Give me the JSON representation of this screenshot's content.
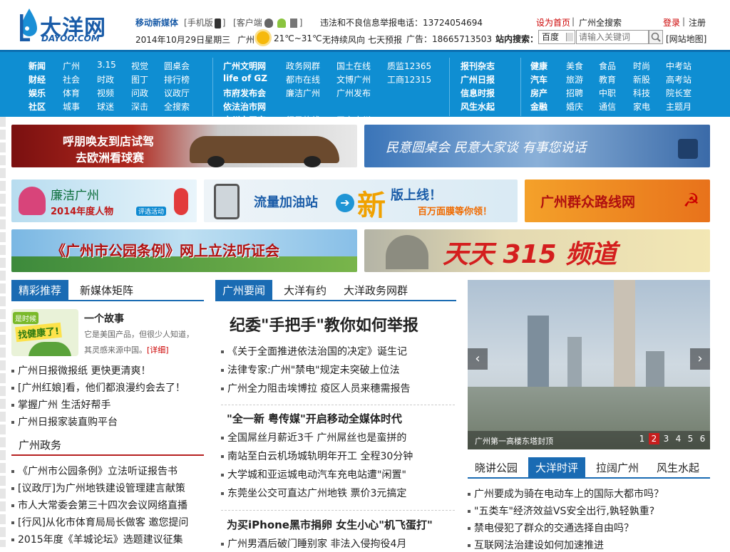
{
  "header": {
    "logo_cn": "大洋网",
    "logo_en": "DAYOO.COM",
    "new_media_label": "移动新媒体",
    "phone_version": "手机版",
    "client": "客户端",
    "report_phone": "违法和不良信息举报电话：13724054694",
    "set_home": "设为首页",
    "gz_search": "广州全搜索",
    "login": "登录",
    "register": "注册",
    "date": "2014年10月29日星期三",
    "city": "广州",
    "temp": "21℃~31℃",
    "wind": "无持续风向",
    "forecast": "七天预报",
    "ad_phone": "广告：18665713503",
    "site_search_label": "站内搜索：",
    "search_select": "百度",
    "search_placeholder": "请输入关键词",
    "sitemap": "[网站地图]"
  },
  "nav": {
    "group1": [
      [
        "新闻",
        "广州",
        "3.15",
        "视觉",
        "圆桌会"
      ],
      [
        "财经",
        "社会",
        "时政",
        "图丁",
        "排行榜"
      ],
      [
        "娱乐",
        "体育",
        "视频",
        "问政",
        "议政厅"
      ],
      [
        "社区",
        "城事",
        "球迷",
        "深击",
        "全搜索"
      ]
    ],
    "group2": [
      [
        "广州文明网",
        "政务网群",
        "国土在线",
        "质监12365"
      ],
      [
        "life of GZ",
        "都市在线",
        "文博广州",
        "工商12315"
      ],
      [
        "市府发布会",
        "廉洁广州",
        "广州发布",
        ""
      ],
      [
        "依法治市网",
        "",
        "",
        ""
      ],
      [
        "广州市平安",
        "行风热线",
        "平安广州",
        ""
      ]
    ],
    "group3": [
      "报刊杂志",
      "广州日报",
      "信息时报",
      "风生水起"
    ],
    "group4": [
      [
        "健康",
        "美食",
        "食品",
        "时尚",
        "中考站"
      ],
      [
        "汽车",
        "旅游",
        "教育",
        "新股",
        "高考站"
      ],
      [
        "房产",
        "招聘",
        "中职",
        "科技",
        "院长室"
      ],
      [
        "金融",
        "婚庆",
        "通信",
        "家电",
        "主题月"
      ]
    ]
  },
  "banners": {
    "car": [
      "呼朋唤友到店试驾",
      "去欧洲看球赛"
    ],
    "round_table": "民意圆桌会 民意大家谈 有事您说话",
    "lianjie": [
      "廉洁广州",
      "2014年度人物"
    ],
    "lianjie_tag": "评选活动",
    "traffic": "流量加油站",
    "traffic_new": "新",
    "traffic_online": "版上线！",
    "traffic_sub": "百万面膜等你领！",
    "mass_line": "广州群众路线网",
    "park_law": "《广州市公园条例》网上立法听证会",
    "consumer": "天天 315 频道"
  },
  "left": {
    "tabs": [
      "精彩推荐",
      "新媒体矩阵"
    ],
    "story_badge1": "是时候",
    "story_badge2": "找健康了!",
    "story_title": "一个故事",
    "story_desc": [
      "它是美国产品，但很少人知道，",
      "其灵感来源中国。"
    ],
    "story_more": "[详细]",
    "items": [
      "广州日报微报纸 更快更清爽！",
      "[广州红娘]看，他们都浪漫约会去了！",
      "掌握广州 生活好帮手",
      "广州日报家装直购平台"
    ],
    "gov_title": "广州政务",
    "gov_items": [
      "《广州市公园条例》立法听证报告书",
      "[议政厅]为广州地铁建设管理建言献策",
      "市人大常委会第三十四次会议网络直播",
      "[行风]从化市体育局局长做客 邀您提问",
      "2015年度《羊城论坛》选题建议征集"
    ]
  },
  "middle": {
    "tabs": [
      "广州要闻",
      "大洋有约",
      "大洋政务网群"
    ],
    "headline": "纪委\"手把手\"教你如何举报",
    "items1": [
      "《关于全面推进依法治国的决定》诞生记",
      "法律专家:广州\"禁电\"规定未突破上位法",
      "广州全力阻击埃博拉 疫区人员来穗需报告"
    ],
    "sub1": "\"全一新 粤传媒\"开启移动全媒体时代",
    "items2": [
      "全国屌丝月薪近3千 广州屌丝也是蛮拼的",
      "南站至白云机场城轨明年开工 全程30分钟",
      "大学城和亚运城电动汽车充电站遭\"闲置\"",
      "东莞坐公交可直达广州地铁 票价3元搞定"
    ],
    "sub2": "为买iPhone黑市捐卵 女生小心\"机飞蛋打\"",
    "items3": [
      "广州男酒后破门睡别家 非法入侵拘役4月"
    ]
  },
  "right": {
    "caption": "广州第一高楼东塔封顶",
    "pages": [
      "1",
      "2",
      "3",
      "4",
      "5",
      "6"
    ],
    "active_page": "2",
    "tabs": [
      "晓讲公园",
      "大洋时评",
      "拉阔广州",
      "风生水起"
    ],
    "items": [
      "广州要成为骑在电动车上的国际大都市吗？",
      "\"五类车\"经济效益VS安全出行,孰轻孰重?",
      "禁电侵犯了群众的交通选择自由吗？",
      "互联网法治建设如何加速推进"
    ]
  }
}
